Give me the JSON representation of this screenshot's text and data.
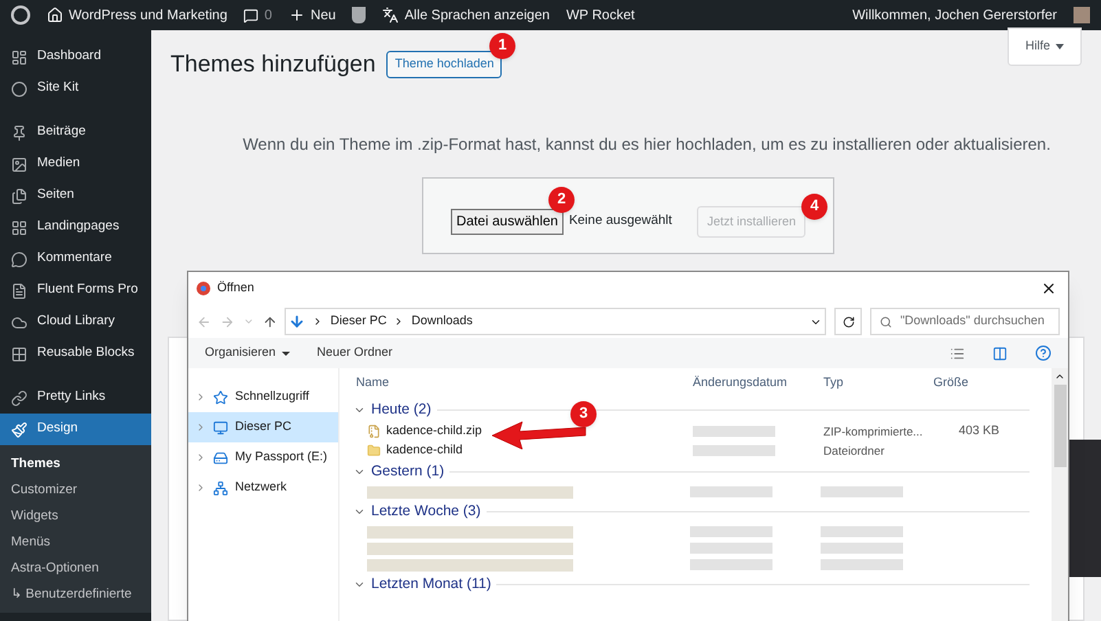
{
  "admin_bar": {
    "site": "WordPress und Marketing",
    "comments": "0",
    "new": "Neu",
    "languages": "Alle Sprachen anzeigen",
    "rocket": "WP Rocket",
    "greeting": "Willkommen, Jochen Gererstorfer"
  },
  "sidebar": {
    "items": [
      {
        "label": "Dashboard",
        "selected": false
      },
      {
        "label": "Site Kit",
        "selected": false
      },
      {
        "label": "Beiträge",
        "selected": false
      },
      {
        "label": "Medien",
        "selected": false
      },
      {
        "label": "Seiten",
        "selected": false
      },
      {
        "label": "Landingpages",
        "selected": false
      },
      {
        "label": "Kommentare",
        "selected": false
      },
      {
        "label": "Fluent Forms Pro",
        "selected": false
      },
      {
        "label": "Cloud Library",
        "selected": false
      },
      {
        "label": "Reusable Blocks",
        "selected": false
      },
      {
        "label": "Pretty Links",
        "selected": false
      },
      {
        "label": "Design",
        "selected": true,
        "children": [
          {
            "label": "Themes",
            "selected": true
          },
          {
            "label": "Customizer",
            "selected": false
          },
          {
            "label": "Widgets",
            "selected": false
          },
          {
            "label": "Menüs",
            "selected": false
          },
          {
            "label": "Astra-Optionen",
            "selected": false
          },
          {
            "label": "↳ Benutzerdefinierte",
            "selected": false
          }
        ]
      }
    ]
  },
  "page": {
    "title": "Themes hinzufügen",
    "upload_button": "Theme hochladen",
    "help_button": "Hilfe",
    "description": "Wenn du ein Theme im .zip-Format hast, kannst du es hier hochladen, um es zu installieren oder aktualisieren.",
    "file_button": "Datei auswählen",
    "file_status": "Keine ausgewählt",
    "install_button": {
      "label": "Jetzt installieren",
      "disabled": true
    }
  },
  "dialog": {
    "title": "Öffnen",
    "breadcrumb": [
      "Dieser PC",
      "Downloads"
    ],
    "search_placeholder": "\"Downloads\" durchsuchen",
    "toolbar": [
      "Organisieren",
      "Neuer Ordner"
    ],
    "nav": [
      {
        "label": "Schnellzugriff",
        "selected": false
      },
      {
        "label": "Dieser PC",
        "selected": true
      },
      {
        "label": "My Passport (E:)",
        "selected": false
      },
      {
        "label": "Netzwerk",
        "selected": false
      }
    ],
    "columns": [
      "Name",
      "Änderungsdatum",
      "Typ",
      "Größe"
    ],
    "groups": [
      {
        "label": "Heute (2)",
        "rows": [
          {
            "kind": "zip",
            "name": "kadence-child.zip",
            "type": "ZIP-komprimierte...",
            "size": "403 KB"
          },
          {
            "kind": "folder",
            "name": "kadence-child",
            "type": "Dateiordner"
          }
        ]
      },
      {
        "label": "Gestern (1)",
        "rows": [
          {
            "kind": "blurred"
          }
        ]
      },
      {
        "label": "Letzte Woche (3)",
        "rows": [
          {
            "kind": "blurred"
          },
          {
            "kind": "blurred"
          },
          {
            "kind": "blurred"
          }
        ]
      },
      {
        "label": "Letzten Monat (11)"
      }
    ]
  },
  "annotations": [
    "1",
    "2",
    "3",
    "4"
  ]
}
